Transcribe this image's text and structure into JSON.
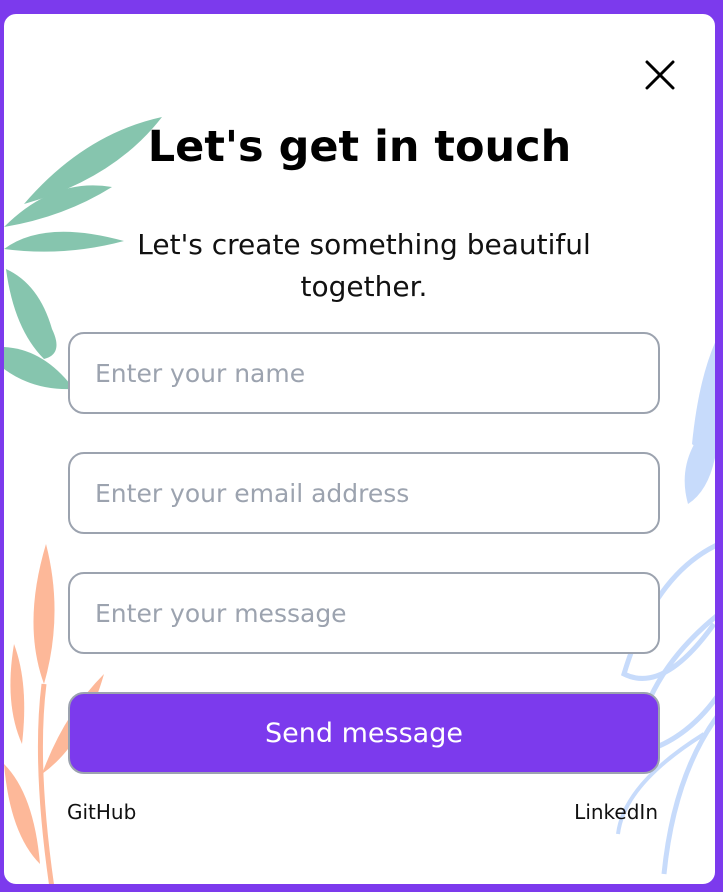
{
  "modal": {
    "title": "Let's get in touch",
    "subtitle": "Let's create something beautiful together."
  },
  "form": {
    "name_placeholder": "Enter your name",
    "email_placeholder": "Enter your email address",
    "message_placeholder": "Enter your message",
    "submit_label": "Send message"
  },
  "footer": {
    "github_label": "GitHub",
    "linkedin_label": "LinkedIn"
  },
  "icons": {
    "close": "close-icon"
  },
  "colors": {
    "accent": "#7c3aed",
    "leaf_green": "#86c5ae",
    "leaf_peach": "#fdb899",
    "leaf_blue": "#c7dbfb",
    "field_border": "#9ca3af"
  }
}
